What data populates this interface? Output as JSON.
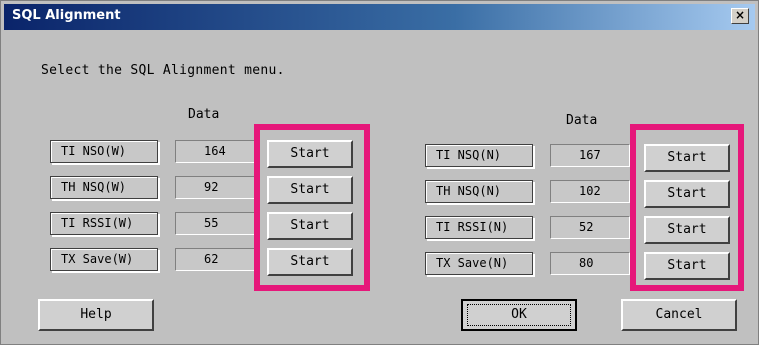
{
  "window": {
    "title": "SQL Alignment",
    "close_label": "×"
  },
  "instruction": "Select the SQL Alignment menu.",
  "left_panel": {
    "data_header": "Data",
    "rows": [
      {
        "label": "TI NSO(W)",
        "value": "164",
        "button": "Start"
      },
      {
        "label": "TH NSQ(W)",
        "value": "92",
        "button": "Start"
      },
      {
        "label": "TI RSSI(W)",
        "value": "55",
        "button": "Start"
      },
      {
        "label": "TX Save(W)",
        "value": "62",
        "button": "Start"
      }
    ]
  },
  "right_panel": {
    "data_header": "Data",
    "rows": [
      {
        "label": "TI NSQ(N)",
        "value": "167",
        "button": "Start"
      },
      {
        "label": "TH NSQ(N)",
        "value": "102",
        "button": "Start"
      },
      {
        "label": "TI RSSI(N)",
        "value": "52",
        "button": "Start"
      },
      {
        "label": "TX Save(N)",
        "value": "80",
        "button": "Start"
      }
    ]
  },
  "footer": {
    "help": "Help",
    "ok": "OK",
    "cancel": "Cancel"
  },
  "colors": {
    "highlight": "#e6177a",
    "title_bar": "#0a246a",
    "dialog_bg": "#c0c0c0"
  }
}
